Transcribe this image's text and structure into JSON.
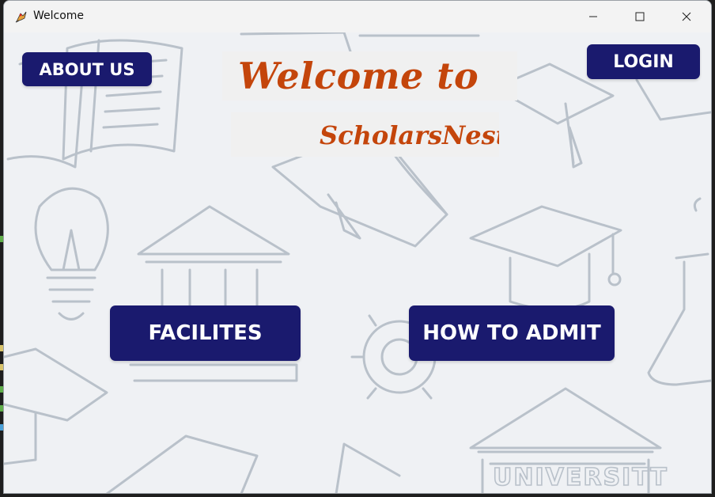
{
  "window": {
    "title": "Welcome"
  },
  "title_controls": {
    "minimize_icon": "minimize-icon",
    "maximize_icon": "maximize-icon",
    "close_icon": "close-icon"
  },
  "nav": {
    "about_label": "ABOUT US",
    "login_label": "LOGIN",
    "facilities_label": "FACILITES",
    "admit_label": "HOW TO ADMIT"
  },
  "banner": {
    "welcome": "Welcome to",
    "name": "ScholarsNest"
  },
  "background": {
    "sign_text": "UNIVERSITT"
  },
  "colors": {
    "button_bg": "#1a1a6e",
    "button_text": "#ffffff",
    "banner_text": "#c4450b",
    "background": "#eff1f4",
    "doodle_stroke": "#b9c1ca"
  }
}
